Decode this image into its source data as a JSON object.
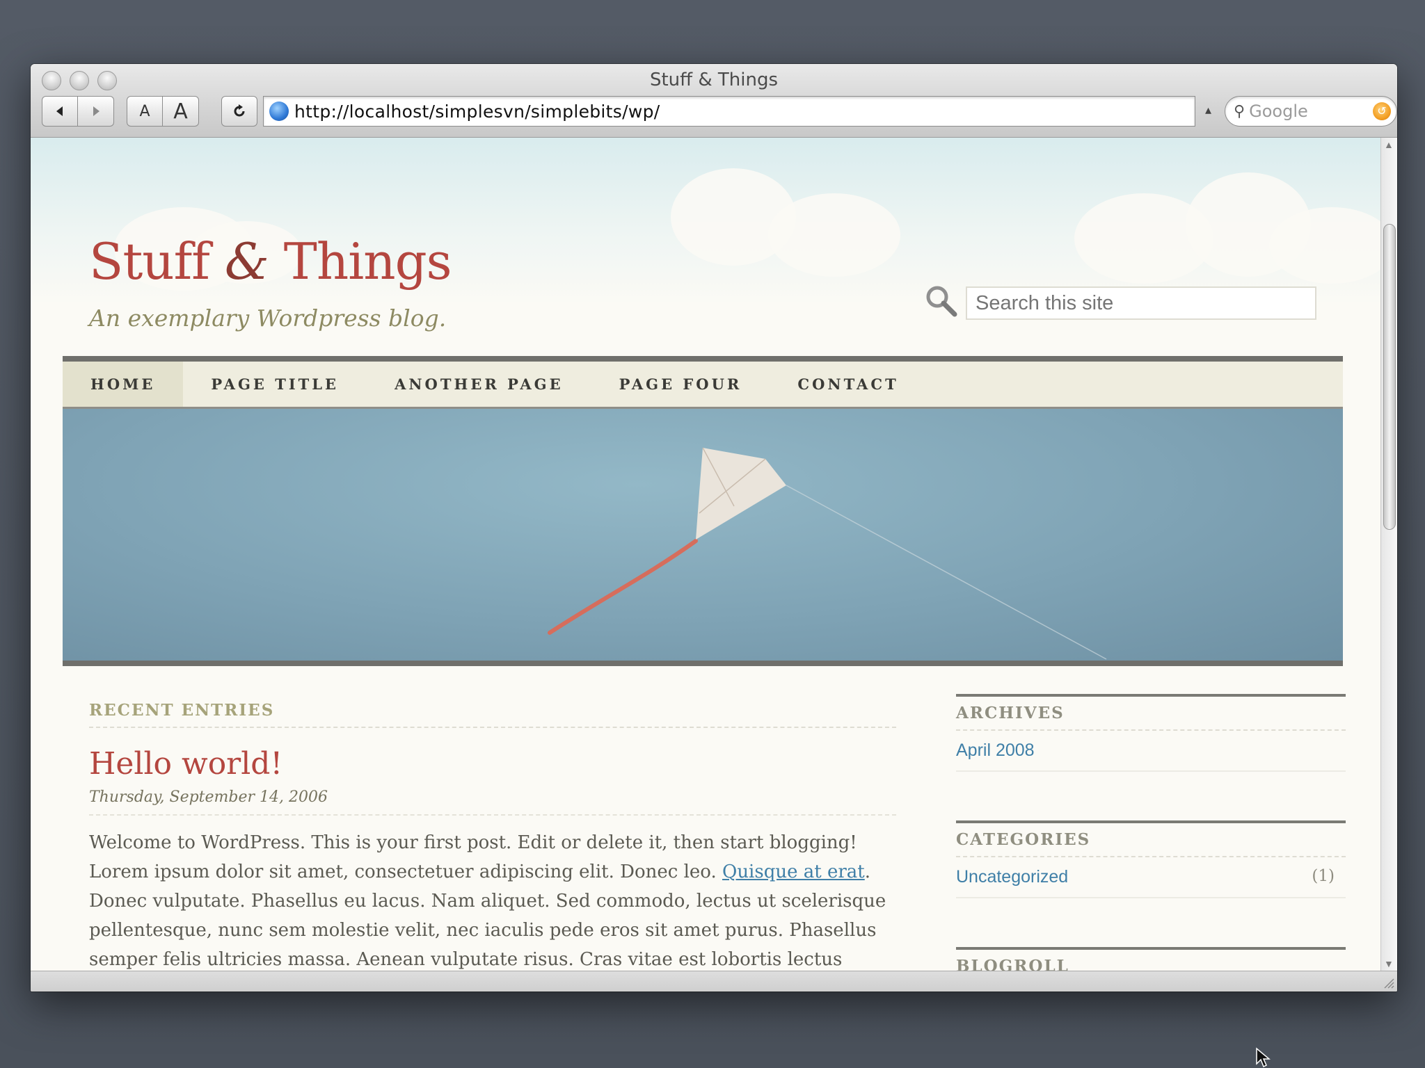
{
  "window": {
    "title": "Stuff & Things"
  },
  "toolbar": {
    "back_icon": "back-arrow-icon",
    "forward_icon": "forward-arrow-icon",
    "text_smaller": "A",
    "text_larger": "A",
    "reload_icon": "reload-icon",
    "url": "http://localhost/simplesvn/simplebits/wp/",
    "search_placeholder": "Google"
  },
  "site": {
    "title_part1": "Stuff ",
    "title_amp": "&",
    "title_part2": "Things",
    "tagline": "An exemplary Wordpress blog.",
    "search_placeholder": "Search this site"
  },
  "nav": {
    "items": [
      {
        "label": "HOME",
        "active": true
      },
      {
        "label": "PAGE TITLE"
      },
      {
        "label": "ANOTHER PAGE"
      },
      {
        "label": "PAGE FOUR"
      },
      {
        "label": "CONTACT"
      }
    ]
  },
  "main": {
    "section_label": "RECENT ENTRIES",
    "post": {
      "title": "Hello world!",
      "date": "Thursday, September 14, 2006",
      "body_before_link": "Welcome to WordPress. This is your first post. Edit or delete it, then start blogging! Lorem ipsum dolor sit amet, consectetuer adipiscing elit. Donec leo. ",
      "link_text": "Quisque at erat",
      "body_after_link": ". Donec vulputate. Phasellus eu lacus. Nam aliquet. Sed commodo, lectus ut scelerisque pellentesque, nunc sem molestie velit, nec iaculis pede eros sit amet purus. Phasellus semper felis ultricies massa. Aenean vulputate risus. Cras vitae est lobortis lectus pretium pulvinar. Nulla non"
    }
  },
  "sidebar": {
    "archives": {
      "title": "ARCHIVES",
      "items": [
        {
          "label": "April 2008"
        }
      ]
    },
    "categories": {
      "title": "CATEGORIES",
      "items": [
        {
          "label": "Uncategorized",
          "count": "(1)"
        }
      ]
    },
    "blogroll": {
      "title": "BLOGROLL"
    }
  },
  "colors": {
    "title_red": "#b4463f",
    "link_blue": "#3f7fa7",
    "tagline_olive": "#8d8a62",
    "hero_blue": "#7fa3b5"
  }
}
